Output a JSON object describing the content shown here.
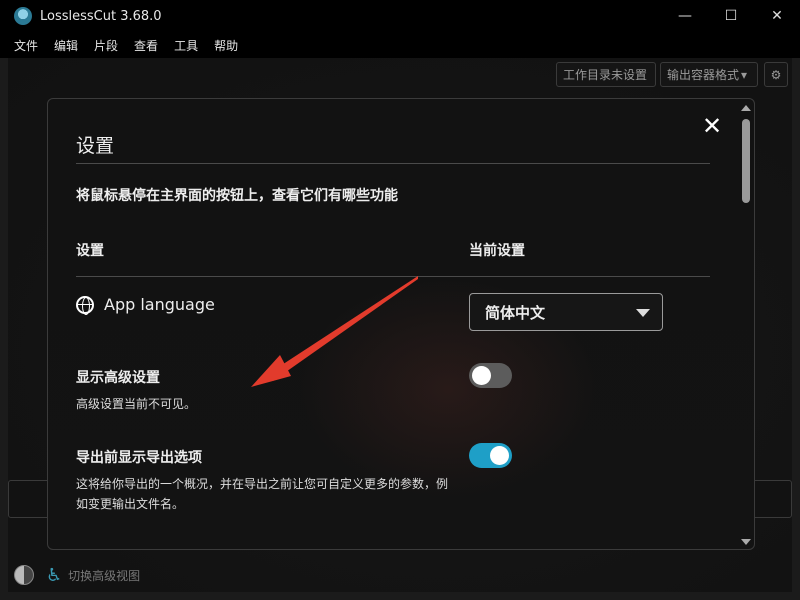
{
  "window": {
    "title": "LosslessCut 3.68.0",
    "controls": {
      "minimize": "—",
      "maximize": "☐",
      "close": "✕"
    }
  },
  "menu": [
    "文件",
    "编辑",
    "片段",
    "查看",
    "工具",
    "帮助"
  ],
  "toolbar": {
    "workdir_label": "工作目录未设置",
    "format_label": "输出容器格式",
    "format_caret": "▾",
    "gear": "⚙"
  },
  "footer": {
    "toggle_label": "切换高级视图"
  },
  "settings": {
    "title": "设置",
    "close": "✕",
    "hint": "将鼠标悬停在主界面的按钮上，查看它们有哪些功能",
    "col_setting": "设置",
    "col_current": "当前设置",
    "language": {
      "label": "App language",
      "value": "简体中文"
    },
    "advanced": {
      "label": "显示高级设置",
      "desc": "高级设置当前不可见。",
      "enabled": false
    },
    "export_options": {
      "label": "导出前显示导出选项",
      "desc": "这将给你导出的一个概况，并在导出之前让您可自定义更多的参数，例如变更输出文件名。",
      "enabled": true
    }
  },
  "colors": {
    "accent": "#1e9fc7",
    "annotation_arrow": "#e23b2c"
  }
}
